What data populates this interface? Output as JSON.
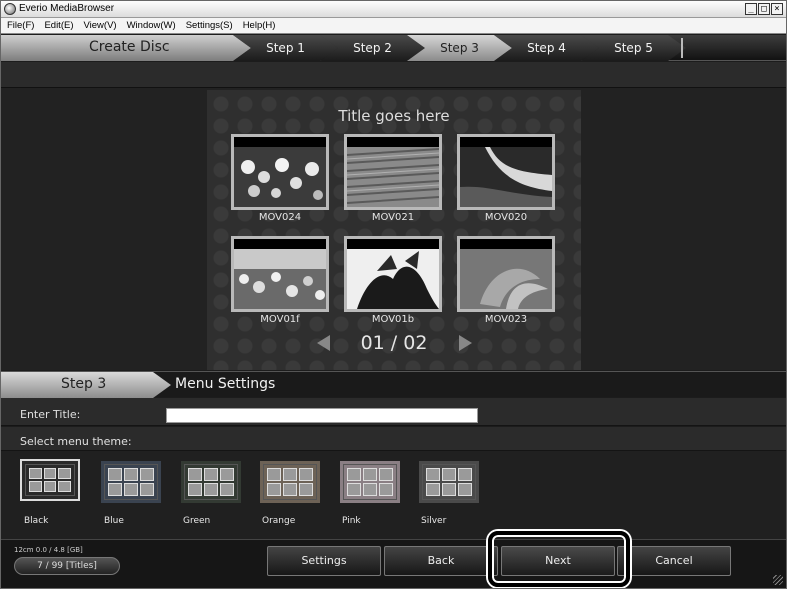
{
  "window": {
    "title": "Everio MediaBrowser",
    "controls": {
      "minimize": "_",
      "maximize": "□",
      "close": "×"
    }
  },
  "menu": [
    "File(F)",
    "Edit(E)",
    "View(V)",
    "Window(W)",
    "Settings(S)",
    "Help(H)"
  ],
  "wizard": {
    "title": "Create Disc",
    "steps": [
      "Step 1",
      "Step 2",
      "Step 3",
      "Step 4",
      "Step 5"
    ],
    "active_step": "Step 3"
  },
  "preview": {
    "menu_title": "Title goes here",
    "thumbnails": [
      {
        "label": "MOV024",
        "scene": "flowers"
      },
      {
        "label": "MOV021",
        "scene": "wood"
      },
      {
        "label": "MOV020",
        "scene": "waterfall"
      },
      {
        "label": "MOV01f",
        "scene": "flower-field"
      },
      {
        "label": "MOV01b",
        "scene": "leaves"
      },
      {
        "label": "MOV023",
        "scene": "lily"
      }
    ],
    "page": "01 / 02"
  },
  "settings": {
    "step_label": "Step 3",
    "section_title": "Menu Settings",
    "enter_title_label": "Enter Title:",
    "title_value": "",
    "theme_label": "Select menu theme:",
    "themes": [
      {
        "name": "Black",
        "color": "#2a2a2a"
      },
      {
        "name": "Blue",
        "color": "#3a4350"
      },
      {
        "name": "Green",
        "color": "#333a33"
      },
      {
        "name": "Orange",
        "color": "#6d6256"
      },
      {
        "name": "Pink",
        "color": "#8a7f84"
      },
      {
        "name": "Silver",
        "color": "#4a4a4a"
      }
    ],
    "selected_theme": "Black"
  },
  "footer": {
    "capacity": "12cm 0.0 / 4.8 [GB]",
    "titles": "7 / 99 [Titles]",
    "buttons": {
      "settings": "Settings",
      "back": "Back",
      "next": "Next",
      "cancel": "Cancel"
    }
  }
}
